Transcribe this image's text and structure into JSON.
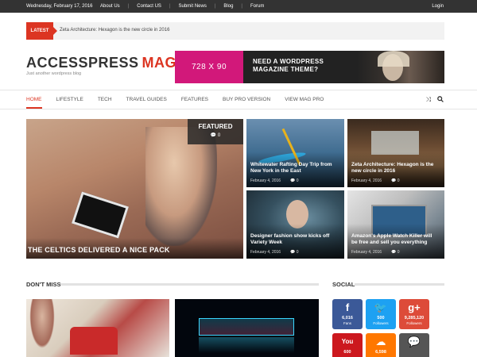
{
  "topbar": {
    "date": "Wednesday, February 17, 2016",
    "links": [
      "About Us",
      "Contact US",
      "Submit News",
      "Blog",
      "Forum"
    ],
    "login": "Login"
  },
  "ticker": {
    "label": "LATEST",
    "text": "Zeta Architecture: Hexagon is the new circle in 2016"
  },
  "logo": {
    "part1": "ACCESSPRESS",
    "part2": "MAG",
    "tagline": "Just another wordpress blog"
  },
  "ad": {
    "size": "728 X 90",
    "line1": "NEED A WORDPRESS",
    "line2": "MAGAZINE THEME?"
  },
  "nav": {
    "items": [
      "HOME",
      "LIFESTYLE",
      "TECH",
      "TRAVEL GUIDES",
      "FEATURES",
      "BUY PRO VERSION",
      "VIEW MAG PRO"
    ],
    "active_index": 0
  },
  "featured": {
    "tag": "FEATURED",
    "comments": "0",
    "title": "THE CELTICS DELIVERED A NICE PACK"
  },
  "posts": [
    {
      "title": "Whitewater Rafting Day Trip from New York in the East",
      "date": "February 4, 2016",
      "comments": "0"
    },
    {
      "title": "Zeta Architecture: Hexagon is the new circle in 2016",
      "date": "February 4, 2016",
      "comments": "0"
    },
    {
      "title": "Designer fashion show kicks off Variety Week",
      "date": "February 4, 2016",
      "comments": "0"
    },
    {
      "title": "Amazon's Apple Watch Killer will be free and sell you everything",
      "date": "February 4, 2016",
      "comments": "0"
    }
  ],
  "sections": {
    "dont_miss": "DON'T MISS",
    "social": "SOCIAL"
  },
  "social": [
    {
      "network": "facebook",
      "icon": "f",
      "count": "6,016",
      "label": "Fans",
      "color": "#3b5998"
    },
    {
      "network": "twitter",
      "icon": "🐦",
      "count": "500",
      "label": "Followers",
      "color": "#1da1f2"
    },
    {
      "network": "google-plus",
      "icon": "g+",
      "count": "9,285,120",
      "label": "Followers",
      "color": "#dd4b39"
    },
    {
      "network": "youtube",
      "icon": "You",
      "count": "600",
      "label": "",
      "color": "#cc181e"
    },
    {
      "network": "soundcloud",
      "icon": "☁",
      "count": "6,598",
      "label": "",
      "color": "#ff7700"
    },
    {
      "network": "comments",
      "icon": "💬",
      "count": "",
      "label": "",
      "color": "#555555"
    }
  ],
  "colors": {
    "accent": "#dc3522",
    "topbar": "#333333"
  }
}
